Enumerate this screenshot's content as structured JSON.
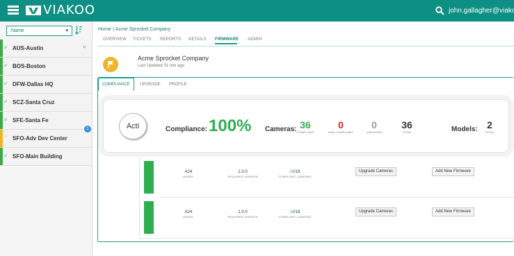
{
  "app": {
    "logo_text": "VIAKOO",
    "user_email": "john.gallagher@viakoo.com"
  },
  "sidebar": {
    "sort_select": "Name",
    "items": [
      {
        "label": "AUS-Austin",
        "status": "ok"
      },
      {
        "label": "BOS-Boston",
        "status": "ok"
      },
      {
        "label": "DFW-Dallas HQ",
        "status": "ok"
      },
      {
        "label": "SCZ-Santa Cruz",
        "status": "ok"
      },
      {
        "label": "SFE-Santa Fe",
        "status": "ok"
      },
      {
        "label": "SFO-Adv Dev Center",
        "status": "warn",
        "badge": "1"
      },
      {
        "label": "SFO-Main Building",
        "status": "ok"
      }
    ]
  },
  "breadcrumb": "Home ⟩ Acme Sprocket Company",
  "tabs": [
    "OVERVIEW",
    "TICKETS",
    "REPORTS",
    "DETAILS",
    "FIRMWARE",
    "ADMIN"
  ],
  "active_tab": "FIRMWARE",
  "site": {
    "name": "Acme Sprocket Company",
    "updated": "Last Updated 31 min ago"
  },
  "subtabs": [
    "COMPLIANCE",
    "UPGRADE",
    "PROFILE"
  ],
  "summary": {
    "vendor_logo": "Acti",
    "compliance_label": "Compliance:",
    "compliance_value": "100%",
    "cameras_label": "Cameras:",
    "stats": [
      {
        "value": "36",
        "caption": "COMPLIANT",
        "color": "#2fae4e"
      },
      {
        "value": "0",
        "caption": "NON-COMPLIANT",
        "color": "#cc1f1f"
      },
      {
        "value": "0",
        "caption": "UNKNOWN",
        "color": "#999999"
      },
      {
        "value": "36",
        "caption": "TOTAL",
        "color": "#333333"
      }
    ],
    "models_label": "Models:",
    "models_value": "2",
    "models_caption": "TOTAL"
  },
  "firmware_rows": [
    {
      "model": "A24",
      "model_caption": "MODEL",
      "version": "1.0.0",
      "version_caption": "REQUIRED VERSION",
      "compliant": "18",
      "total": "/18",
      "compliant_caption": "COMPLIANT CAMERAS",
      "upgrade_button": "Upgrade Cameras",
      "add_button": "Add New Firmware"
    },
    {
      "model": "A24",
      "model_caption": "MODEL",
      "version": "1.0.0",
      "version_caption": "REQUIRED VERSION",
      "compliant": "18",
      "total": "/18",
      "compliant_caption": "COMPLIANT CAMERAS",
      "upgrade_button": "Upgrade Cameras",
      "add_button": "Add New Firmware"
    }
  ]
}
